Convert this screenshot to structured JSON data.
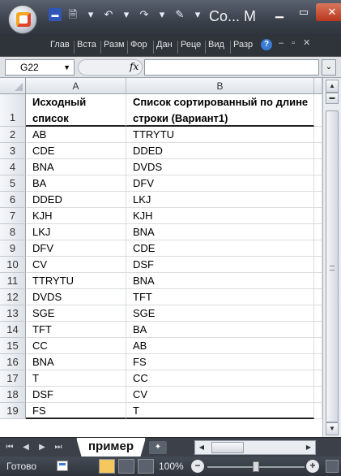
{
  "app": {
    "window_title": "Со... М",
    "qat_icons": [
      "save-icon",
      "print-preview-icon",
      "undo-icon",
      "redo-icon",
      "spelling-icon"
    ]
  },
  "ribbon": {
    "tabs": [
      "Глав",
      "Вста",
      "Разм",
      "Фор",
      "Дан",
      "Реце",
      "Вид",
      "Разр"
    ],
    "help_label": "?"
  },
  "formula_bar": {
    "name_box": "G22",
    "fx_label": "fx",
    "value": ""
  },
  "sheet": {
    "columns": [
      "A",
      "B"
    ],
    "header_row": {
      "row_number": "1",
      "a_line1": "Исходный",
      "a_line2": "список",
      "b_line1": "Список сортированный по длине",
      "b_line2": "строки (Вариант1)"
    },
    "rows": [
      {
        "n": "2",
        "a": "AB",
        "b": "TTRYTU"
      },
      {
        "n": "3",
        "a": "CDE",
        "b": "DDED"
      },
      {
        "n": "4",
        "a": "BNA",
        "b": "DVDS"
      },
      {
        "n": "5",
        "a": "BA",
        "b": "DFV"
      },
      {
        "n": "6",
        "a": "DDED",
        "b": "LKJ"
      },
      {
        "n": "7",
        "a": "KJH",
        "b": "KJH"
      },
      {
        "n": "8",
        "a": "LKJ",
        "b": "BNA"
      },
      {
        "n": "9",
        "a": "DFV",
        "b": "CDE"
      },
      {
        "n": "10",
        "a": "CV",
        "b": "DSF"
      },
      {
        "n": "11",
        "a": "TTRYTU",
        "b": "BNA"
      },
      {
        "n": "12",
        "a": "DVDS",
        "b": "TFT"
      },
      {
        "n": "13",
        "a": "SGE",
        "b": "SGE"
      },
      {
        "n": "14",
        "a": "TFT",
        "b": "BA"
      },
      {
        "n": "15",
        "a": "CC",
        "b": "AB"
      },
      {
        "n": "16",
        "a": "BNA",
        "b": "FS"
      },
      {
        "n": "17",
        "a": "T",
        "b": "CC"
      },
      {
        "n": "18",
        "a": "DSF",
        "b": "CV"
      },
      {
        "n": "19",
        "a": "FS",
        "b": "T"
      }
    ]
  },
  "sheet_tabs": {
    "active": "пример"
  },
  "status_bar": {
    "status": "Готово",
    "zoom": "100%",
    "zoom_level_percent": 100
  }
}
